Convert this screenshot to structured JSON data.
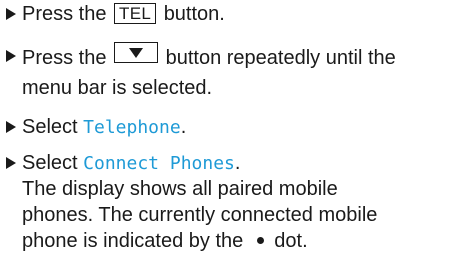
{
  "steps": [
    {
      "before": "Press the",
      "key": "TEL",
      "after": "button."
    },
    {
      "before": "Press the",
      "key_icon": "down-arrow-icon",
      "after": "button repeatedly until the",
      "line2": "menu bar is selected."
    },
    {
      "before": "Select",
      "display": "Telephone",
      "after": "."
    },
    {
      "before": "Select",
      "display": "Connect Phones",
      "after": ".",
      "line2": "The display shows all paired mobile",
      "line3": "phones. The currently connected mobile",
      "line4_before": "phone is indicated by the",
      "line4_icon": "bullet-dot-icon",
      "line4_after": "dot."
    }
  ]
}
